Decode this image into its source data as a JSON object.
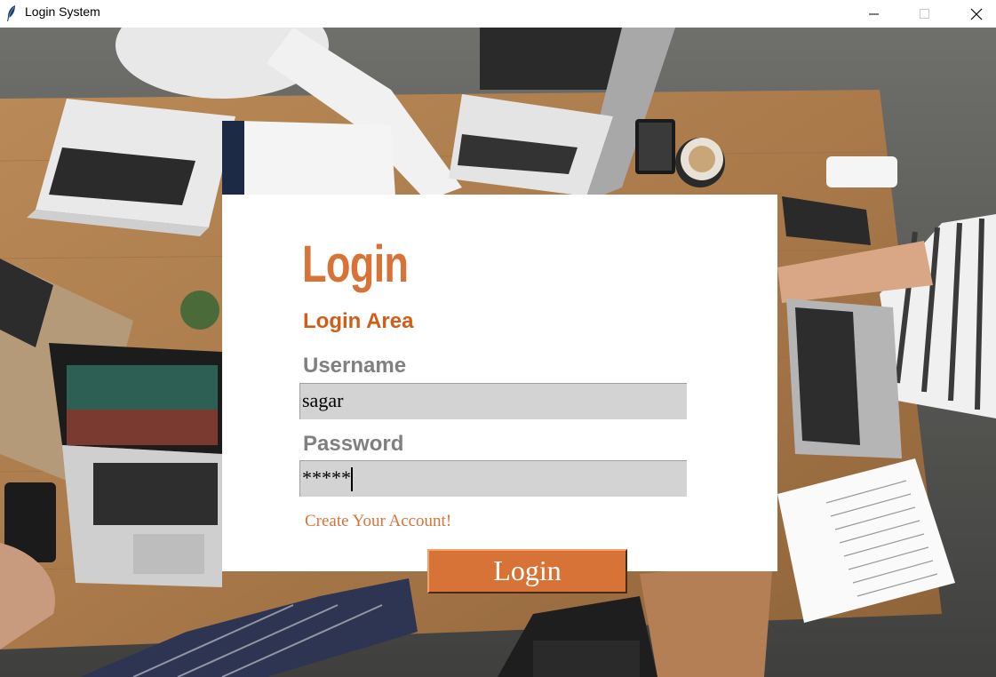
{
  "window": {
    "title": "Login System",
    "icon": "feather-icon",
    "controls": [
      "minimize-icon",
      "maximize-icon",
      "close-icon"
    ]
  },
  "login_form": {
    "heading": "Login",
    "subheading": "Login Area",
    "username_label": "Username",
    "username_value": "sagar",
    "password_label": "Password",
    "password_value": "*****",
    "create_account_link": "Create Your Account!",
    "login_button": "Login"
  },
  "colors": {
    "accent": "#d77337",
    "subheading": "#d25d17",
    "label": "#808080",
    "field_bg": "#d3d3d3"
  }
}
